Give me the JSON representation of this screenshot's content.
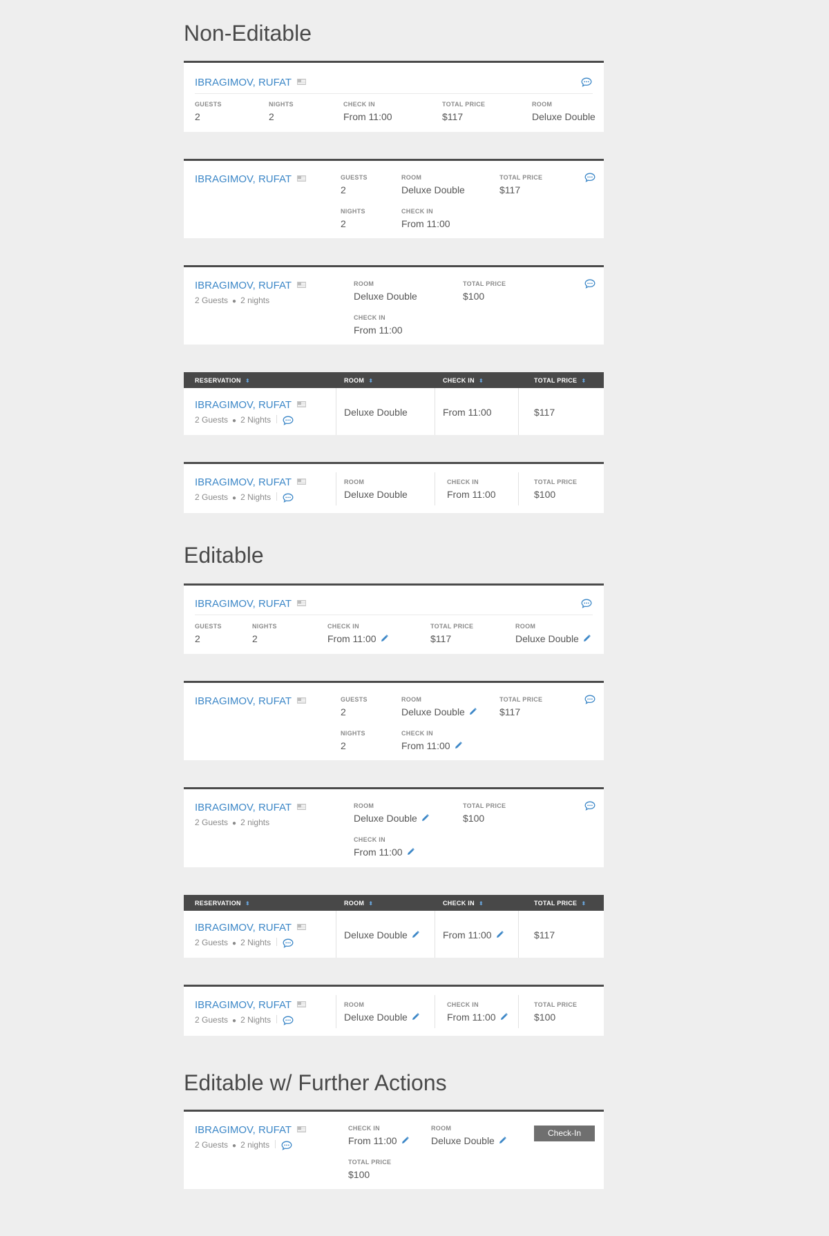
{
  "sections": {
    "non_editable": "Non-Editable",
    "editable": "Editable",
    "further": "Editable w/ Further Actions"
  },
  "guest": {
    "name": "IBRAGIMOV, RUFAT",
    "guests_count": "2",
    "nights_count": "2",
    "guests_nights_lower": "2 Guests",
    "nights_lower": "2 nights",
    "nights_title": "2 Nights"
  },
  "labels": {
    "guests": "GUESTS",
    "nights": "NIGHTS",
    "check_in": "CHECK IN",
    "total_price": "TOTAL PRICE",
    "room": "ROOM",
    "reservation": "RESERVATION"
  },
  "values": {
    "check_in": "From 11:00",
    "room": "Deluxe Double",
    "price_117": "$117",
    "price_100": "$100"
  },
  "actions": {
    "check_in_button": "Check-In"
  },
  "colors": {
    "accent": "#3c87c7",
    "header_bar": "#4a4a4a",
    "button": "#6f6f6f",
    "background": "#eeeeee"
  },
  "icons": {
    "chat": "chat-bubble-icon",
    "edit": "pencil-icon",
    "flag": "flag-icon",
    "sort": "sort-icon"
  }
}
